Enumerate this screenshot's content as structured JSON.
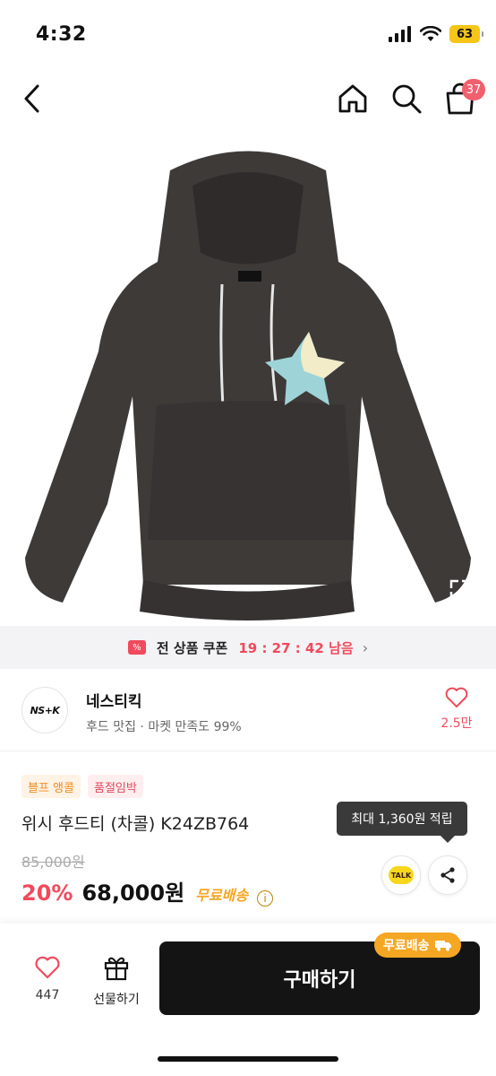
{
  "status_bar": {
    "time": "4:32",
    "battery": "63"
  },
  "nav": {
    "cart_count": "37"
  },
  "coupon": {
    "icon": "%",
    "label": "전 상품 쿠폰",
    "timer": "19 : 27 : 42 남음",
    "chevron": "›"
  },
  "seller": {
    "logo": "NS+K",
    "name": "네스티킥",
    "description": "후드 맛집 · 마켓 만족도 99%",
    "like_count": "2.5만"
  },
  "product": {
    "tags": [
      "블프 앵콜",
      "품절임박"
    ],
    "title": "위시 후드티 (차콜) K24ZB764",
    "points_tooltip": "최대 1,360원 적립",
    "original_price": "85,000원",
    "discount": "20%",
    "sale_price": "68,000원",
    "shipping": "무료배송",
    "talk_label": "TALK"
  },
  "bottom_bar": {
    "like_count": "447",
    "gift_label": "선물하기",
    "buy_label": "구매하기",
    "buy_badge": "무료배송"
  },
  "colors": {
    "accent_red": "#f04a5c",
    "accent_orange": "#f5a623",
    "buy_button": "#141414",
    "hoodie": "#3d3a38"
  }
}
